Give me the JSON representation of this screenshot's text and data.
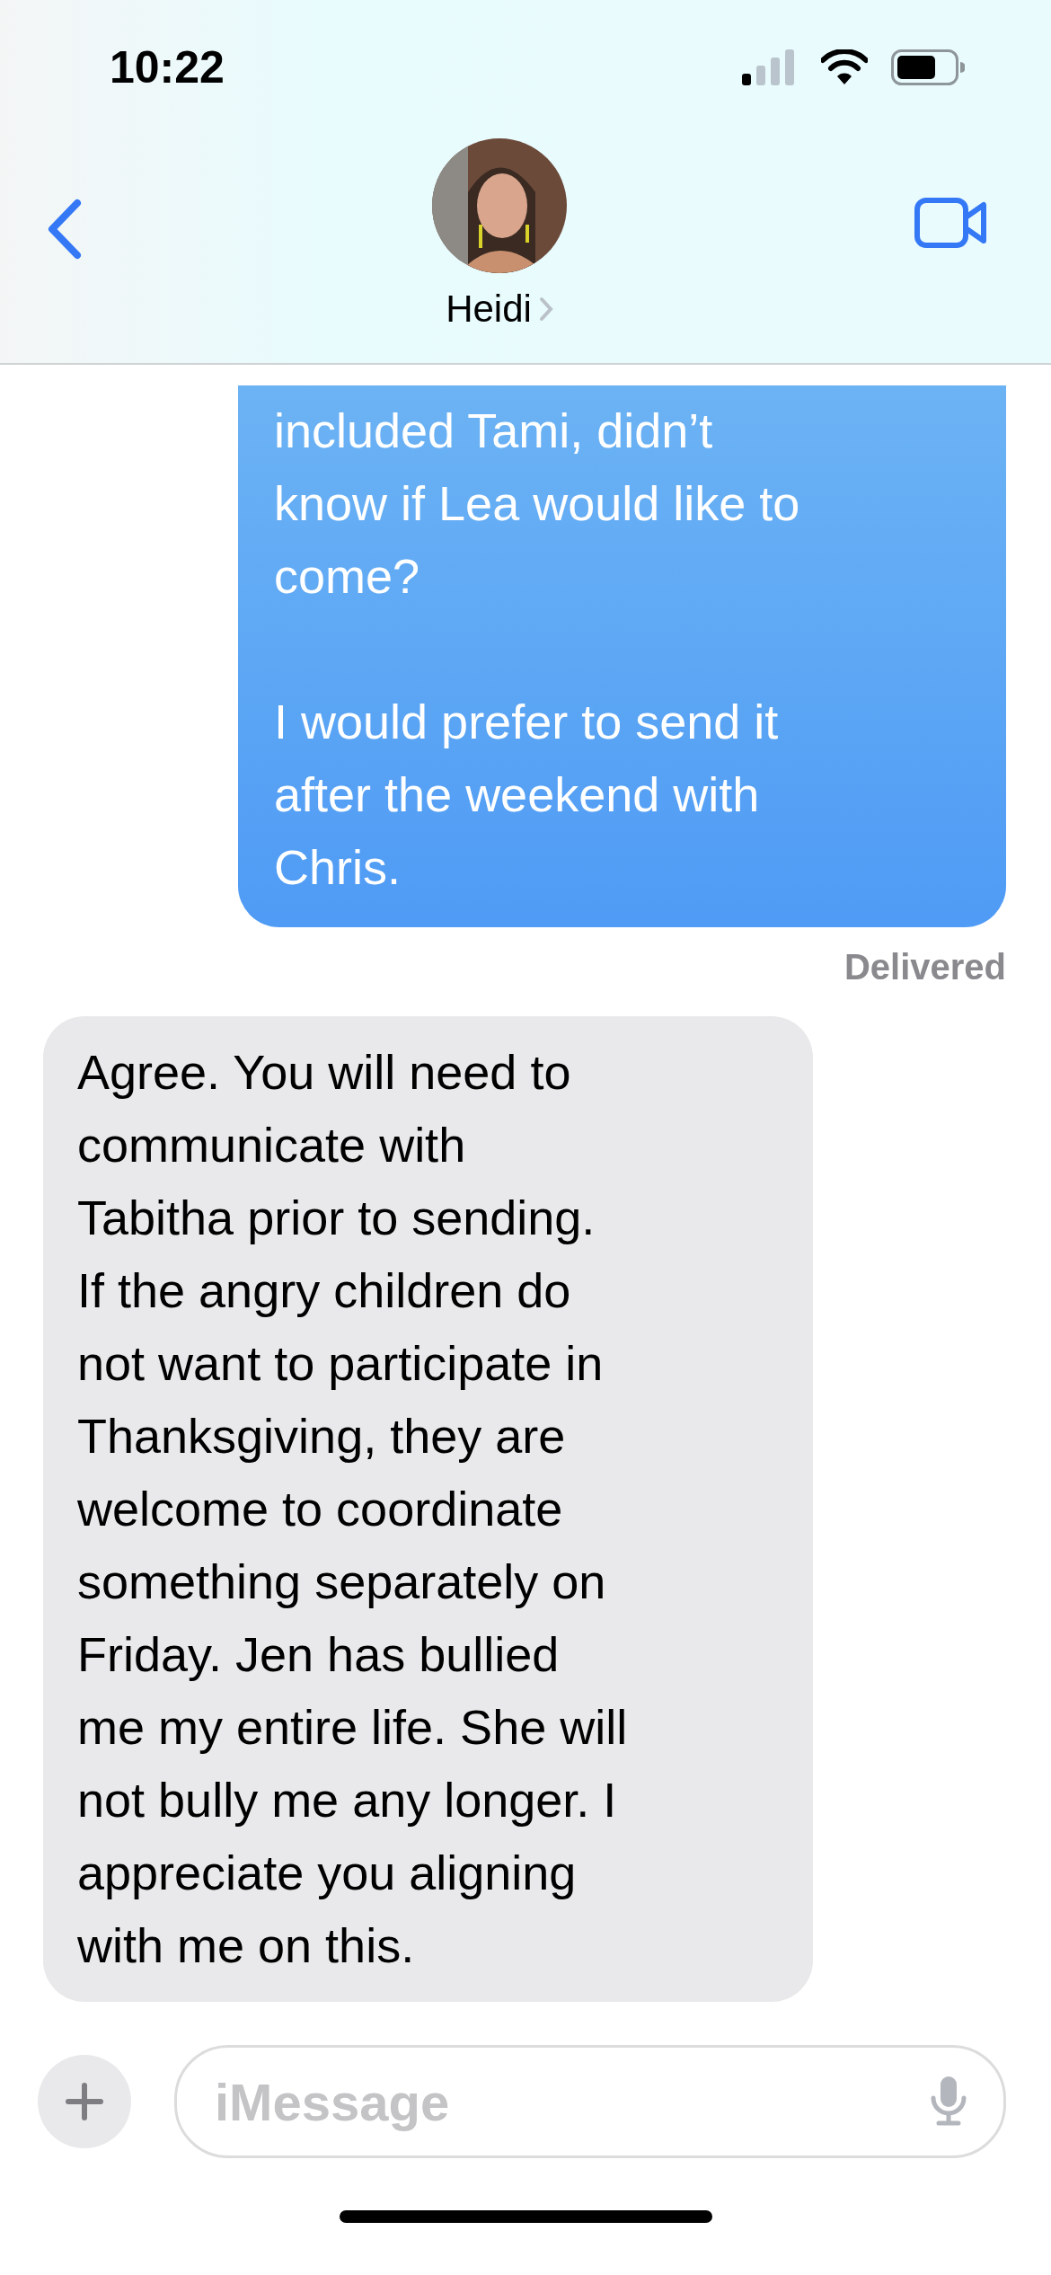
{
  "status_bar": {
    "time": "10:22"
  },
  "header": {
    "contact_name": "Heidi"
  },
  "messages": [
    {
      "kind": "sent",
      "text": "included Tami, didn’t\nknow if Lea would like to\ncome?\n\nI would prefer to send it\nafter the weekend with\nChris.",
      "status": "Delivered"
    },
    {
      "kind": "received",
      "text": "Agree. You will need to\ncommunicate with\nTabitha prior to sending.\nIf the angry children do\nnot want to participate in\nThanksgiving, they are\nwelcome to coordinate\nsomething separately on\nFriday. Jen has bullied\nme my entire life. She will\nnot bully me any longer. I\nappreciate you aligning\nwith me on this."
    }
  ],
  "composer": {
    "placeholder": "iMessage"
  }
}
